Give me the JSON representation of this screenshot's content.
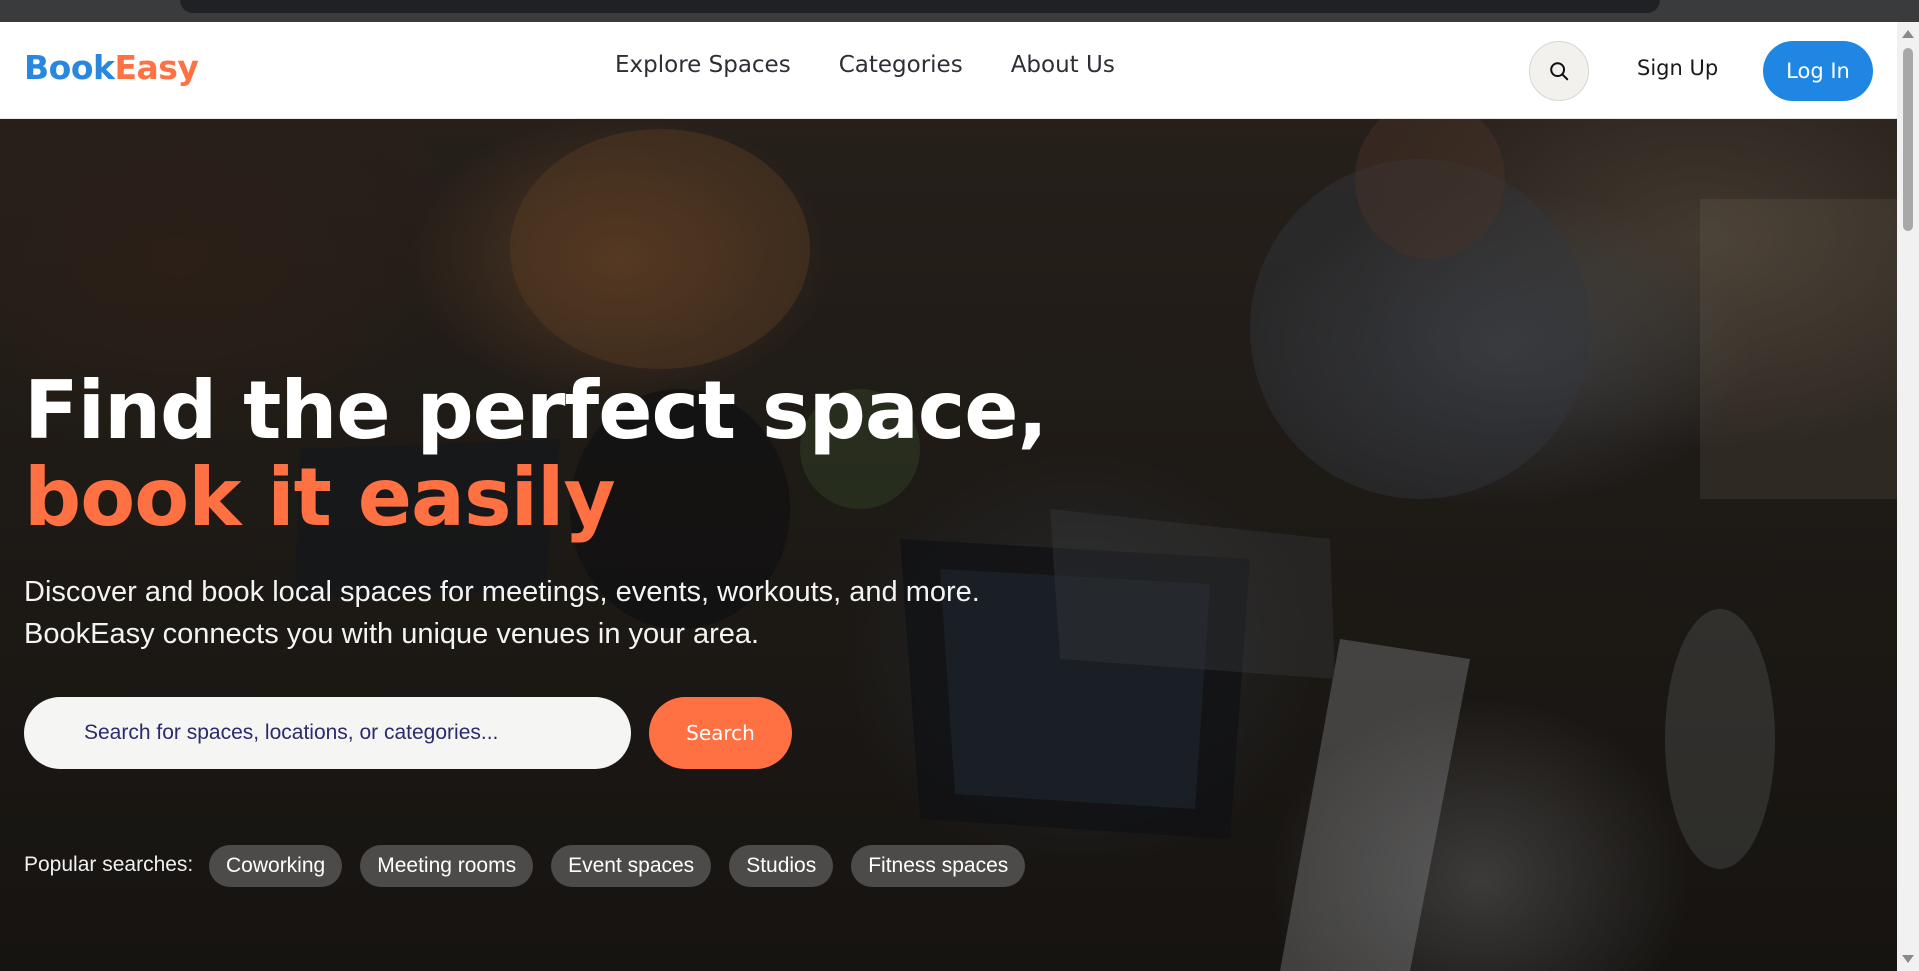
{
  "brand": {
    "part1": "Book",
    "part2": "Easy",
    "color_primary": "#2a87e0",
    "color_accent": "#ff7043"
  },
  "nav": {
    "items": [
      "Explore Spaces",
      "Categories",
      "About Us"
    ]
  },
  "header": {
    "search_icon": "search-icon",
    "signup_label": "Sign Up",
    "login_label": "Log In"
  },
  "hero": {
    "headline_line1": "Find the perfect space,",
    "headline_line2": "book it easily",
    "subtext": "Discover and book local spaces for meetings, events, workouts, and more. BookEasy connects you with unique venues in your area.",
    "search_placeholder": "Search for spaces, locations, or categories...",
    "search_button": "Search",
    "popular_label": "Popular searches:",
    "popular_tags": [
      "Coworking",
      "Meeting rooms",
      "Event spaces",
      "Studios",
      "Fitness spaces"
    ]
  }
}
